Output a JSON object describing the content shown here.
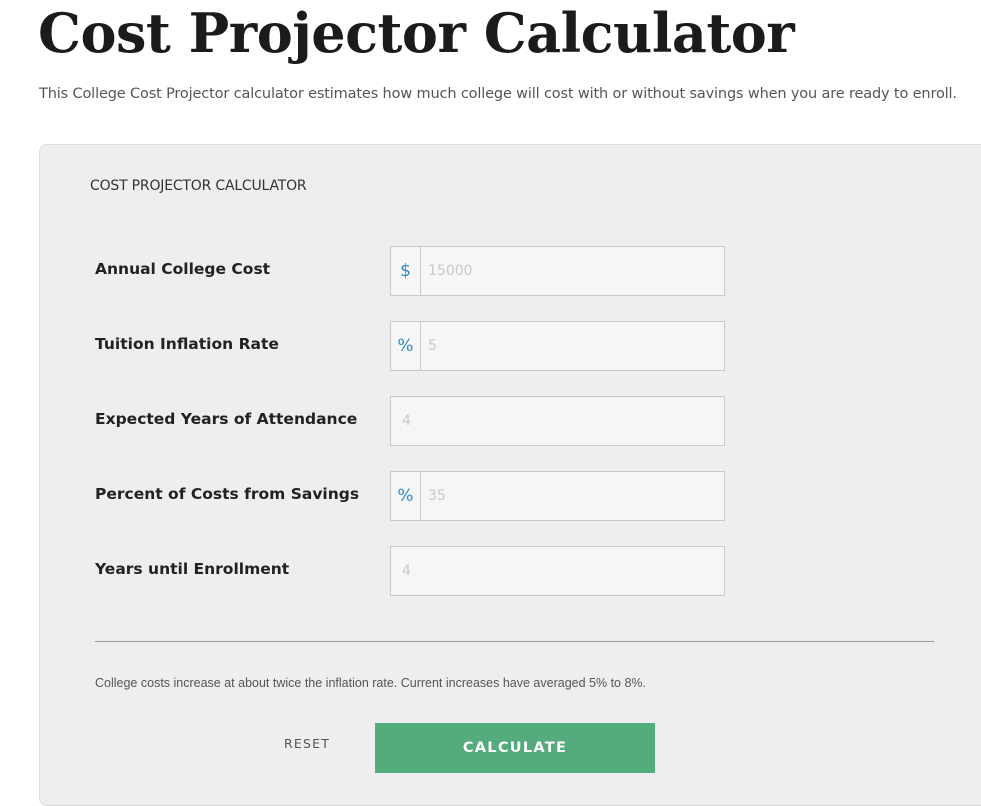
{
  "header": {
    "title": "Cost Projector Calculator",
    "intro": "This College Cost Projector calculator estimates how much college will cost with or without savings when you are ready to enroll."
  },
  "calculator": {
    "title": "COST PROJECTOR CALCULATOR",
    "fields": [
      {
        "label": "Annual College Cost",
        "addon": "$",
        "addon_icon": "dollar-icon",
        "placeholder": "15000",
        "value": ""
      },
      {
        "label": "Tuition Inflation Rate",
        "addon": "%",
        "addon_icon": "percent-icon",
        "placeholder": "5",
        "value": ""
      },
      {
        "label": "Expected Years of Attendance",
        "addon": null,
        "placeholder": "4",
        "value": ""
      },
      {
        "label": "Percent of Costs from Savings",
        "addon": "%",
        "addon_icon": "percent-icon",
        "placeholder": "35",
        "value": ""
      },
      {
        "label": "Years until Enrollment",
        "addon": null,
        "placeholder": "4",
        "value": ""
      }
    ],
    "note": "College costs increase at about twice the inflation rate. Current increases have averaged 5% to 8%.",
    "reset_label": "RESET",
    "calculate_label": "CALCULATE"
  },
  "colors": {
    "accent_blue": "#2e8bc9",
    "calculate_green": "#54ab7b",
    "panel_bg": "#eeeeee"
  }
}
